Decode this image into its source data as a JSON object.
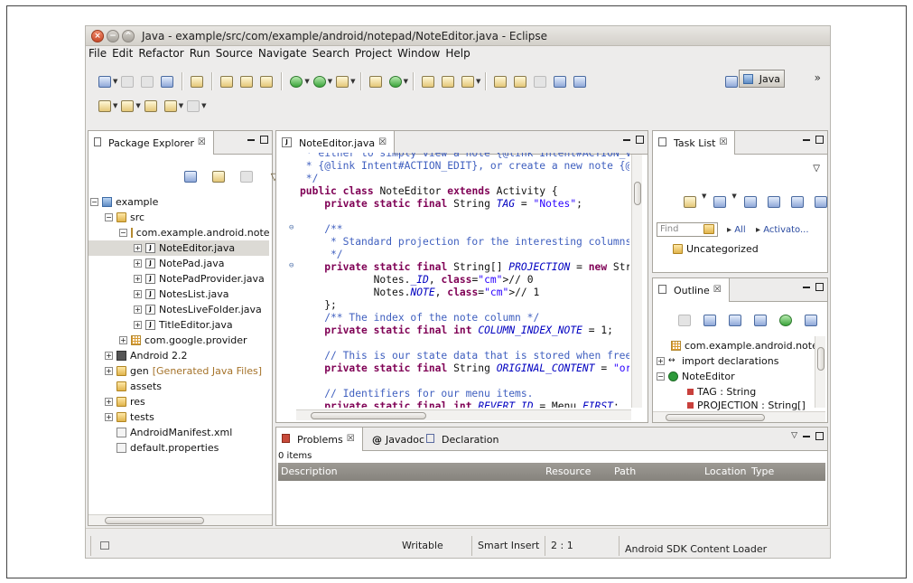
{
  "window": {
    "title": "Java - example/src/com/example/android/notepad/NoteEditor.java - Eclipse"
  },
  "menu": [
    {
      "label": "File"
    },
    {
      "label": "Edit"
    },
    {
      "label": "Refactor"
    },
    {
      "label": "Run"
    },
    {
      "label": "Source"
    },
    {
      "label": "Navigate"
    },
    {
      "label": "Search"
    },
    {
      "label": "Project"
    },
    {
      "label": "Window"
    },
    {
      "label": "Help"
    }
  ],
  "toolbar": {
    "perspective_label": "Java",
    "overflow": "»"
  },
  "package_explorer": {
    "tab_label": "Package Explorer",
    "close": "☒",
    "tree": [
      {
        "label": "example",
        "exp": "−",
        "icon": "project",
        "indent": 0
      },
      {
        "label": "src",
        "exp": "−",
        "icon": "folder",
        "indent": 1
      },
      {
        "label": "com.example.android.note",
        "exp": "−",
        "icon": "package",
        "indent": 2
      },
      {
        "label": "NoteEditor.java",
        "exp": "+",
        "icon": "java",
        "indent": 3,
        "selected": true
      },
      {
        "label": "NotePad.java",
        "exp": "+",
        "icon": "java",
        "indent": 3
      },
      {
        "label": "NotePadProvider.java",
        "exp": "+",
        "icon": "java",
        "indent": 3
      },
      {
        "label": "NotesList.java",
        "exp": "+",
        "icon": "java",
        "indent": 3
      },
      {
        "label": "NotesLiveFolder.java",
        "exp": "+",
        "icon": "java",
        "indent": 3
      },
      {
        "label": "TitleEditor.java",
        "exp": "+",
        "icon": "java",
        "indent": 3
      },
      {
        "label": "com.google.provider",
        "exp": "+",
        "icon": "package",
        "indent": 2
      },
      {
        "label": "Android 2.2",
        "exp": "+",
        "icon": "library",
        "indent": 1
      },
      {
        "label": "gen",
        "suffix": "[Generated Java Files]",
        "exp": "+",
        "icon": "folder",
        "indent": 1
      },
      {
        "label": "assets",
        "exp": "",
        "icon": "folder",
        "indent": 1
      },
      {
        "label": "res",
        "exp": "+",
        "icon": "folder",
        "indent": 1
      },
      {
        "label": "tests",
        "exp": "+",
        "icon": "folder",
        "indent": 1
      },
      {
        "label": "AndroidManifest.xml",
        "exp": "",
        "icon": "xml",
        "indent": 1
      },
      {
        "label": "default.properties",
        "exp": "",
        "icon": "file",
        "indent": 1
      }
    ]
  },
  "editor": {
    "tab_label": "NoteEditor.java",
    "close": "☒",
    "lines": [
      " * either to simply view a note {@link Intent#ACTION_VI",
      " * {@link Intent#ACTION_EDIT}, or create a new note {@li",
      " */",
      "public class NoteEditor extends Activity {",
      "    private static final String TAG = \"Notes\";",
      "",
      "    /**",
      "     * Standard projection for the interesting columns o",
      "     */",
      "    private static final String[] PROJECTION = new Strin",
      "            Notes._ID, // 0",
      "            Notes.NOTE, // 1",
      "    };",
      "    /** The index of the note column */",
      "    private static final int COLUMN_INDEX_NOTE = 1;",
      "",
      "    // This is our state data that is stored when freezi",
      "    private static final String ORIGINAL_CONTENT = \"orig",
      "",
      "    // Identifiers for our menu items.",
      "    private static final int REVERT_ID = Menu.FIRST;"
    ]
  },
  "task_list": {
    "tab_label": "Task List",
    "close": "☒",
    "find_placeholder": "Find",
    "all_label": "All",
    "activate_label": "Activato...",
    "category": "Uncategorized"
  },
  "outline": {
    "tab_label": "Outline",
    "close": "☒",
    "items": [
      "com.example.android.notep",
      "import declarations",
      "NoteEditor",
      "TAG : String",
      "PROJECTION : String[]"
    ]
  },
  "bottom": {
    "tabs": [
      {
        "label": "Problems"
      },
      {
        "label": "Javadoc"
      },
      {
        "label": "Declaration"
      }
    ],
    "count": "0 items",
    "columns": [
      "Description",
      "Resource",
      "Path",
      "Location",
      "Type"
    ]
  },
  "status": {
    "writable": "Writable",
    "insert": "Smart Insert",
    "position": "2 : 1",
    "loader": "Android SDK Content Loader"
  }
}
